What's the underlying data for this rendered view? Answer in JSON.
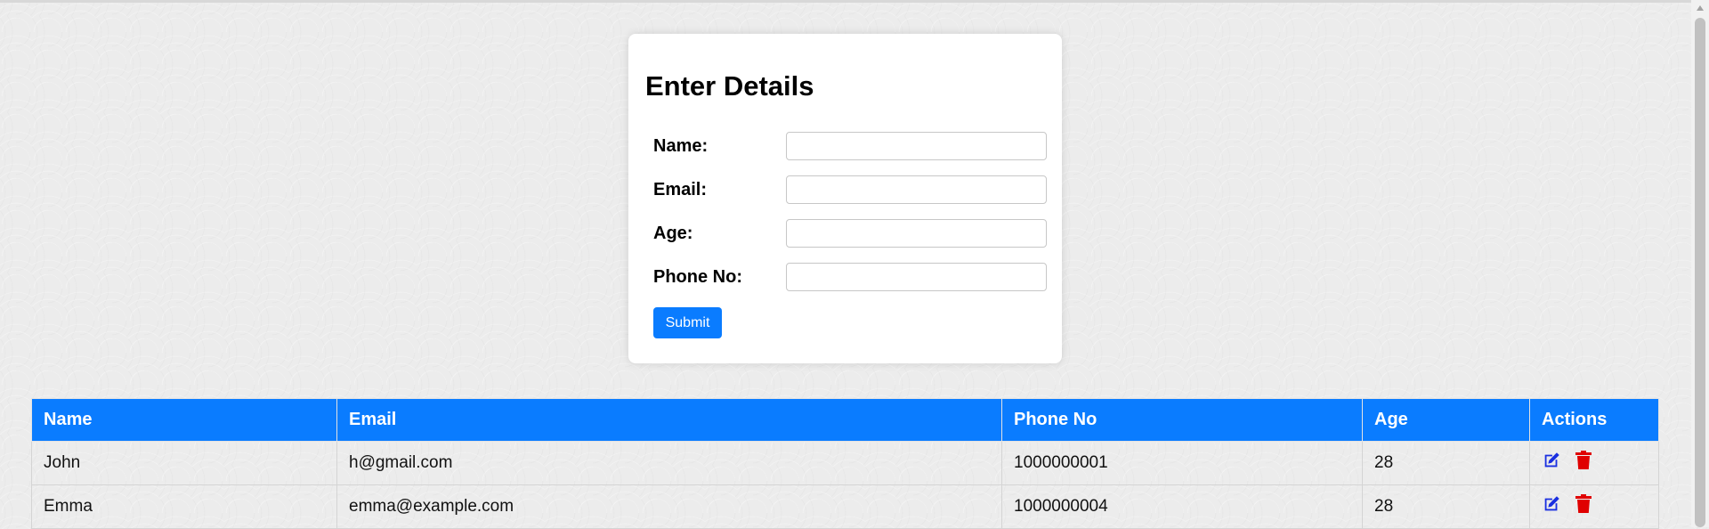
{
  "form": {
    "title": "Enter Details",
    "fields": [
      {
        "label": "Name:",
        "value": ""
      },
      {
        "label": "Email:",
        "value": ""
      },
      {
        "label": "Age:",
        "value": ""
      },
      {
        "label": "Phone No:",
        "value": ""
      }
    ],
    "submit_label": "Submit"
  },
  "table": {
    "headers": [
      "Name",
      "Email",
      "Phone No",
      "Age",
      "Actions"
    ],
    "rows": [
      {
        "name": "John",
        "email": "h@gmail.com",
        "phone": "1000000001",
        "age": "28"
      },
      {
        "name": "Emma",
        "email": "emma@example.com",
        "phone": "1000000004",
        "age": "28"
      }
    ]
  },
  "icons": {
    "edit": "edit-icon",
    "delete": "trash-icon",
    "scroll_up": "chevron-up-icon"
  },
  "colors": {
    "accent": "#0a7cff",
    "edit_icon": "#1a2fe0",
    "delete_icon": "#e00000"
  }
}
